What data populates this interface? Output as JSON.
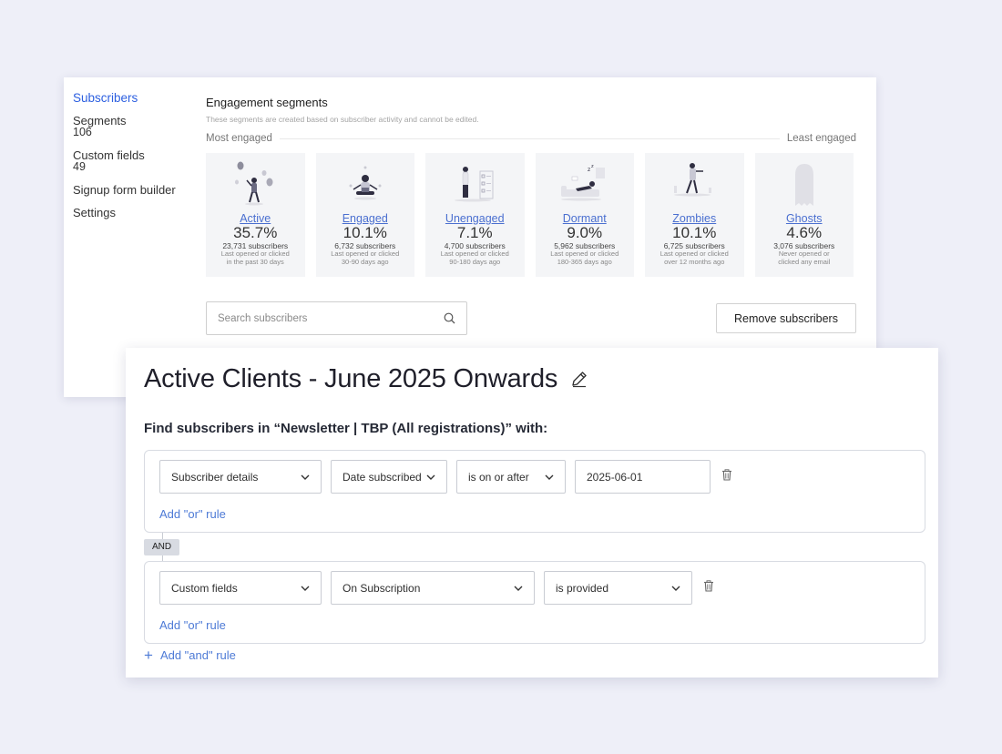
{
  "sidebar": {
    "items": [
      {
        "label": "Subscribers",
        "count": ""
      },
      {
        "label": "Segments",
        "count": "106"
      },
      {
        "label": "Custom fields",
        "count": "49"
      },
      {
        "label": "Signup form builder",
        "count": ""
      },
      {
        "label": "Settings",
        "count": ""
      }
    ]
  },
  "segments": {
    "title": "Engagement segments",
    "description": "These segments are created based on subscriber activity and cannot be edited.",
    "scale_left": "Most engaged",
    "scale_right": "Least engaged",
    "cards": [
      {
        "name": "Active",
        "percent": "35.7%",
        "subscribers": "23,731 subscribers",
        "caption_1": "Last opened or clicked",
        "caption_2": "in the past 30 days"
      },
      {
        "name": "Engaged",
        "percent": "10.1%",
        "subscribers": "6,732 subscribers",
        "caption_1": "Last opened or clicked",
        "caption_2": "30-90 days ago"
      },
      {
        "name": "Unengaged",
        "percent": "7.1%",
        "subscribers": "4,700 subscribers",
        "caption_1": "Last opened or clicked",
        "caption_2": "90-180 days ago"
      },
      {
        "name": "Dormant",
        "percent": "9.0%",
        "subscribers": "5,962 subscribers",
        "caption_1": "Last opened or clicked",
        "caption_2": "180-365 days ago"
      },
      {
        "name": "Zombies",
        "percent": "10.1%",
        "subscribers": "6,725 subscribers",
        "caption_1": "Last opened or clicked",
        "caption_2": "over 12 months ago"
      },
      {
        "name": "Ghosts",
        "percent": "4.6%",
        "subscribers": "3,076 subscribers",
        "caption_1": "Never opened or",
        "caption_2": "clicked any email"
      }
    ]
  },
  "search": {
    "placeholder": "Search subscribers",
    "icon": "search-icon"
  },
  "remove_button": "Remove subscribers",
  "segment_editor": {
    "title": "Active Clients - June 2025 Onwards",
    "find_text": "Find subscribers in “Newsletter | TBP (All registrations)” with:",
    "rule1": {
      "field": "Subscriber details",
      "subfield": "Date subscribed",
      "operator": "is on or after",
      "value": "2025-06-01",
      "add_or": "Add \"or\" rule"
    },
    "and_label": "AND",
    "rule2": {
      "field": "Custom fields",
      "subfield": "On Subscription",
      "operator": "is provided",
      "add_or": "Add \"or\" rule"
    },
    "add_and": "Add \"and\" rule"
  },
  "colors": {
    "accent": "#2c5fe0",
    "link": "#4d7ad6",
    "background": "#eeeff8"
  }
}
